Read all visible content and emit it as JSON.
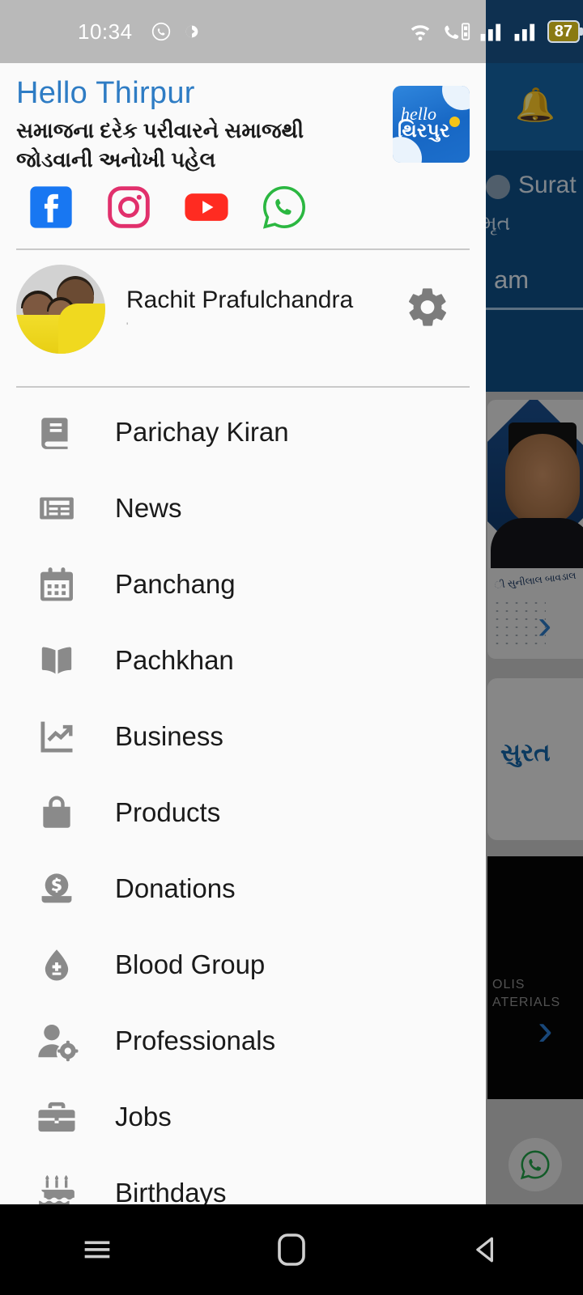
{
  "status_bar": {
    "time": "10:34",
    "icons": [
      "whatsapp-icon",
      "app-icon",
      "wifi-icon",
      "vowifi-call-icon",
      "signal-icon-1",
      "signal-icon-2"
    ],
    "battery_percent": "87"
  },
  "drawer": {
    "title": "Hello Thirpur",
    "subtitle": "સમાજના દરેક પરીવારને સમાજથી જોડવાની અનોખી પહેલ",
    "logo": {
      "script_text": "hello",
      "gujarati_text": "થિરપુર"
    },
    "socials": [
      {
        "name": "facebook-icon",
        "color": "#1877F2"
      },
      {
        "name": "instagram-icon",
        "color": "#E1306C"
      },
      {
        "name": "youtube-icon",
        "color": "#FF0000"
      },
      {
        "name": "whatsapp-icon",
        "color": "#25D366"
      }
    ],
    "profile": {
      "name": "Rachit Prafulchandra",
      "subtext": "'",
      "avatar_name": "user-avatar",
      "settings_icon": "gear-icon"
    },
    "menu": [
      {
        "label": "Parichay Kiran",
        "icon": "book-icon"
      },
      {
        "label": "News",
        "icon": "newspaper-icon"
      },
      {
        "label": "Panchang",
        "icon": "calendar-icon"
      },
      {
        "label": "Pachkhan",
        "icon": "open-book-icon"
      },
      {
        "label": "Business",
        "icon": "trending-up-icon"
      },
      {
        "label": "Products",
        "icon": "shopping-bag-icon"
      },
      {
        "label": "Donations",
        "icon": "donation-coin-icon"
      },
      {
        "label": "Blood Group",
        "icon": "blood-drop-icon"
      },
      {
        "label": "Professionals",
        "icon": "person-gear-icon"
      },
      {
        "label": "Jobs",
        "icon": "briefcase-icon"
      },
      {
        "label": "Birthdays",
        "icon": "birthday-cake-icon"
      }
    ]
  },
  "background_app": {
    "appbar": {
      "notification_icon": "bell-icon"
    },
    "location": {
      "city": "Surat",
      "gujarati": "મૃત",
      "time_suffix": "am"
    },
    "card_photo": {
      "caption": "ી સુનીલાલ બાવડાલ",
      "next_icon": "chevron-right-icon"
    },
    "card_surat": {
      "label": "સુરત"
    },
    "card_dark": {
      "line1": "OLIS",
      "line2": "ATERIALS",
      "next_icon": "chevron-right-icon"
    },
    "fab": {
      "icon": "whatsapp-icon"
    }
  },
  "nav_bar": {
    "buttons": [
      {
        "name": "recents-button",
        "icon": "menu-lines-icon"
      },
      {
        "name": "home-button",
        "icon": "home-square-icon"
      },
      {
        "name": "back-button",
        "icon": "back-triangle-icon"
      }
    ]
  },
  "colors": {
    "accent_blue": "#2e7cc4",
    "drawer_bg": "#fafafa",
    "appbar_blue": "#1565a5",
    "icon_gray": "#8a8a8a"
  }
}
